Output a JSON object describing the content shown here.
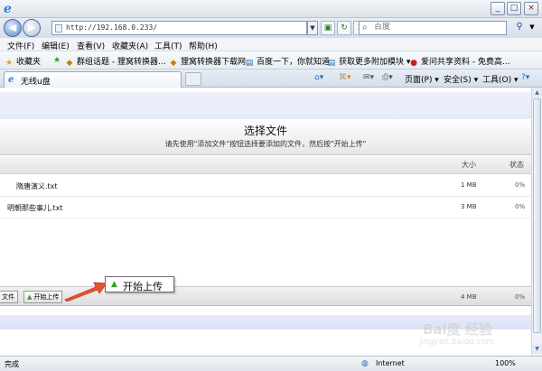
{
  "window": {
    "url": "http://192.168.0.233/",
    "search_placeholder": "百度",
    "minimize": "_",
    "maximize": "□",
    "close": "×"
  },
  "menu": {
    "items": [
      "文件(F)",
      "编辑(E)",
      "查看(V)",
      "收藏夹(A)",
      "工具(T)",
      "帮助(H)"
    ]
  },
  "favorites": {
    "label": "收藏夹",
    "items": [
      "群组话题 - 狸窝转换器...",
      "狸窝转换器下载网",
      "百度一下，你就知道",
      "获取更多附加模块 ▾",
      "爱问共享资料 - 免费高..."
    ]
  },
  "tabs": {
    "active_label": "无线u盘"
  },
  "commands": {
    "page": "页面(P) ▾",
    "safety": "安全(S) ▾",
    "tools": "工具(O) ▾",
    "help": "?▾"
  },
  "uploader": {
    "title": "选择文件",
    "subtitle": "请先使用\"添加文件\"按钮选择要添加的文件，然后按\"开始上传\"",
    "col_size": "大小",
    "col_status": "状态",
    "files": [
      {
        "name": "隋唐演义.txt",
        "size": "1 MB",
        "status": "0%"
      },
      {
        "name": "明朝那些事儿.txt",
        "size": "3 MB",
        "status": "0%"
      }
    ],
    "add_file_label": "文件",
    "start_upload_label": "开始上传",
    "total_size": "4 MB",
    "total_status": "0%"
  },
  "callout": {
    "label": "开始上传"
  },
  "status": {
    "text": "完成",
    "zone": "Internet",
    "zoom": "100%"
  },
  "watermark": {
    "main": "Bai度 经验",
    "sub": "jingyan.baidu.com"
  }
}
